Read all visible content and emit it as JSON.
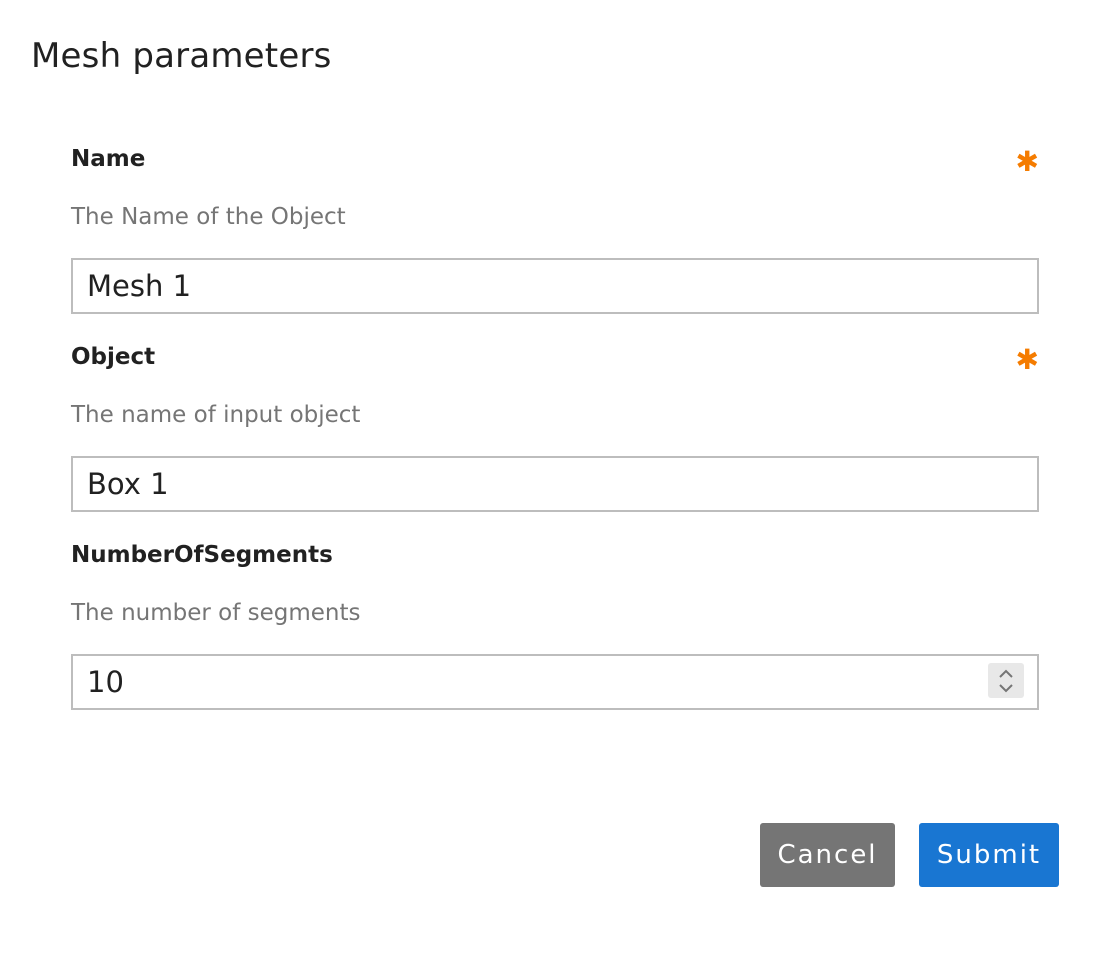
{
  "dialog": {
    "title": "Mesh parameters"
  },
  "fields": [
    {
      "label": "Name",
      "required": true,
      "required_marker": "✱",
      "description": "The Name of the Object",
      "value": "Mesh 1"
    },
    {
      "label": "Object",
      "required": true,
      "required_marker": "✱",
      "description": "The name of input object",
      "value": "Box 1"
    },
    {
      "label": "NumberOfSegments",
      "required": false,
      "description": "The number of segments",
      "value": "10",
      "stepper_icon": "spin-up-down-icon"
    }
  ],
  "actions": {
    "cancel_label": "Cancel",
    "submit_label": "Submit"
  },
  "colors": {
    "required_marker": "#f57c00",
    "cancel_button": "#757575",
    "submit_button": "#1976d2",
    "description_text": "#757575"
  }
}
